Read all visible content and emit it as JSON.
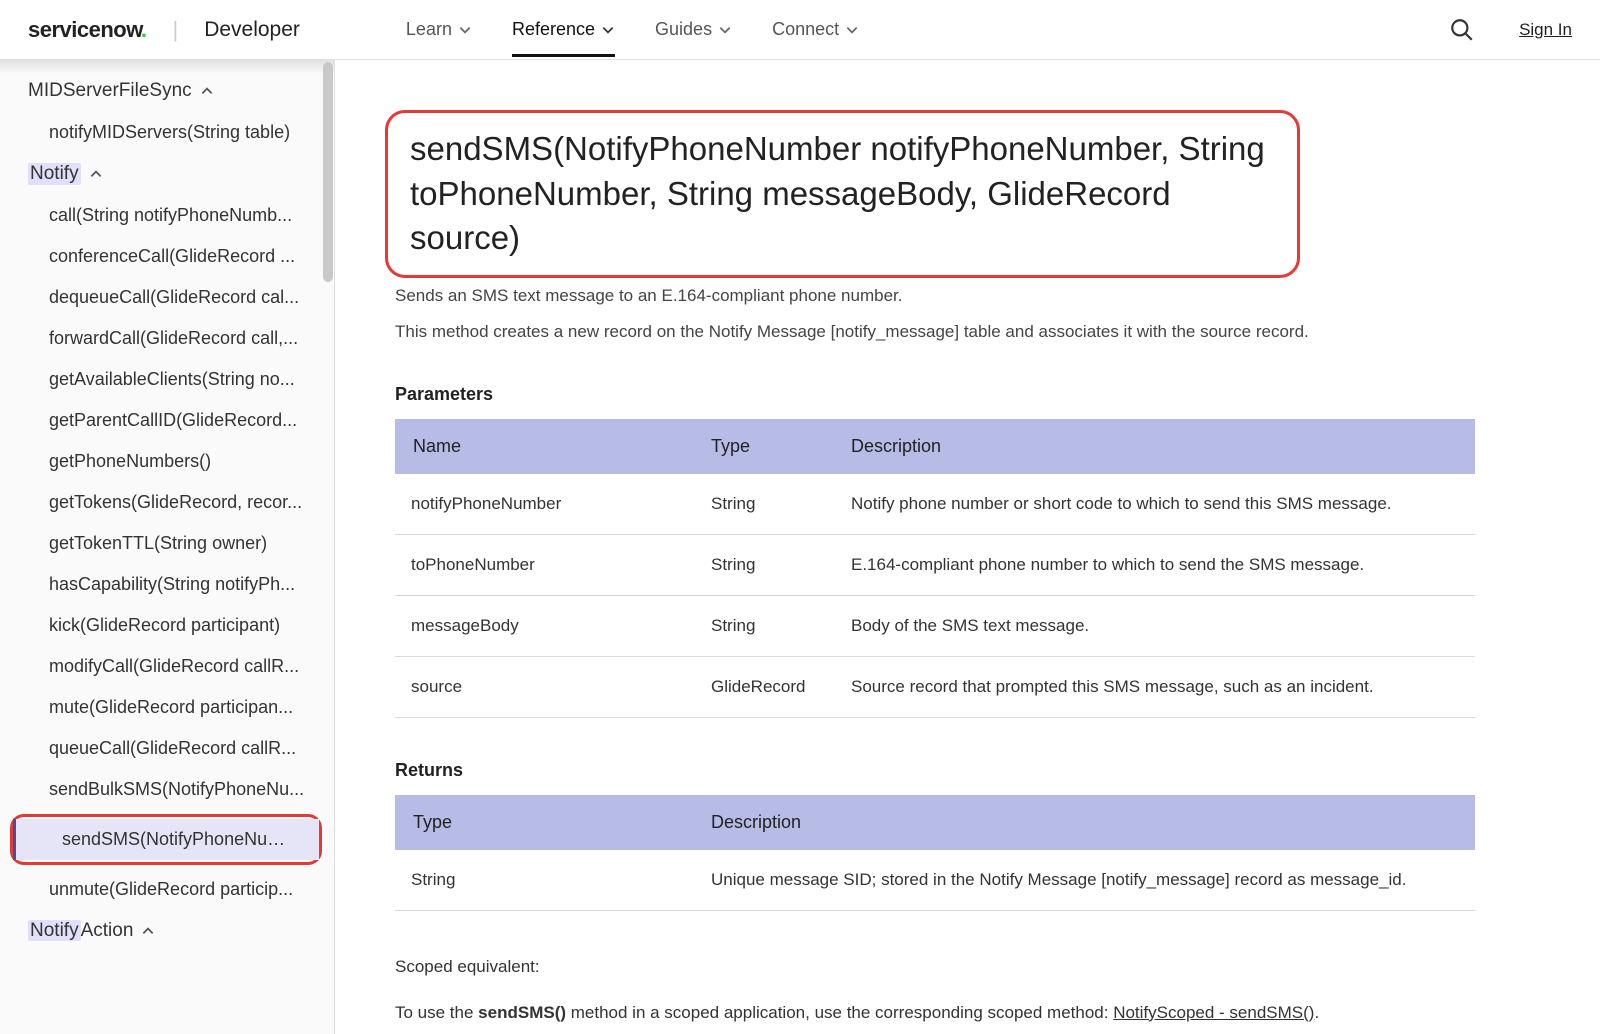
{
  "header": {
    "brand": "servicenow",
    "portal": "Developer",
    "nav": {
      "learn": "Learn",
      "reference": "Reference",
      "guides": "Guides",
      "connect": "Connect"
    },
    "sign_in": "Sign In"
  },
  "sidebar": {
    "sec1": {
      "label": "MIDServerFileSync",
      "items": {
        "notifyMID": "notifyMIDServers(String table)"
      }
    },
    "sec2": {
      "label": "Notify",
      "items": {
        "call": "call(String notifyPhoneNumb...",
        "conferenceCall": "conferenceCall(GlideRecord ...",
        "dequeueCall": "dequeueCall(GlideRecord cal...",
        "forwardCall": "forwardCall(GlideRecord call,...",
        "getAvailableClients": "getAvailableClients(String no...",
        "getParentCallID": "getParentCallID(GlideRecord...",
        "getPhoneNumbers": "getPhoneNumbers()",
        "getTokens": "getTokens(GlideRecord, recor...",
        "getTokenTTL": "getTokenTTL(String owner)",
        "hasCapability": "hasCapability(String notifyPh...",
        "kick": "kick(GlideRecord participant)",
        "modifyCall": "modifyCall(GlideRecord callR...",
        "mute": "mute(GlideRecord participan...",
        "queueCall": "queueCall(GlideRecord callR...",
        "sendBulkSMS": "sendBulkSMS(NotifyPhoneNu...",
        "sendSMS": "sendSMS(NotifyPhoneNumbe...",
        "unmute": "unmute(GlideRecord particip..."
      }
    },
    "sec3": {
      "label": "NotifyAction"
    }
  },
  "main": {
    "title": "sendSMS(NotifyPhoneNumber notifyPhoneNumber, String toPhoneNumber, String messageBody, GlideRecord source)",
    "desc1": "Sends an SMS text message to an E.164-compliant phone number.",
    "desc2": "This method creates a new record on the Notify Message [notify_message] table and associates it with the source record.",
    "parameters_title": "Parameters",
    "param_head": {
      "name": "Name",
      "type": "Type",
      "desc": "Description"
    },
    "params": [
      {
        "name": "notifyPhoneNumber",
        "type": "String",
        "desc": "Notify phone number or short code to which to send this SMS message."
      },
      {
        "name": "toPhoneNumber",
        "type": "String",
        "desc": "E.164-compliant phone number to which to send the SMS message."
      },
      {
        "name": "messageBody",
        "type": "String",
        "desc": "Body of the SMS text message."
      },
      {
        "name": "source",
        "type": "GlideRecord",
        "desc": "Source record that prompted this SMS message, such as an incident."
      }
    ],
    "returns_title": "Returns",
    "returns_head": {
      "type": "Type",
      "desc": "Description"
    },
    "returns": {
      "type": "String",
      "desc": "Unique message SID; stored in the Notify Message [notify_message] record as message_id."
    },
    "scoped_title": "Scoped equivalent:",
    "scoped_pre": "To use the ",
    "scoped_bold": "sendSMS()",
    "scoped_mid": " method in a scoped application, use the corresponding scoped method: ",
    "scoped_link": "NotifyScoped - sendSMS()",
    "scoped_post": "."
  }
}
